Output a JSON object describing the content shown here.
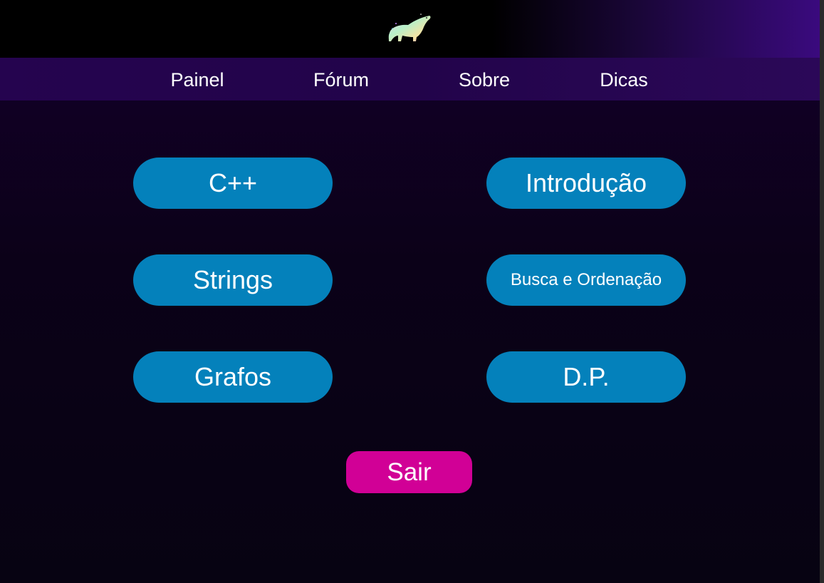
{
  "header": {
    "logo_icon": "polar-bear-logo-icon"
  },
  "nav": {
    "items": [
      {
        "label": "Painel"
      },
      {
        "label": "Fórum"
      },
      {
        "label": "Sobre"
      },
      {
        "label": "Dicas"
      }
    ]
  },
  "topics": {
    "buttons": [
      {
        "label": "C++"
      },
      {
        "label": "Introdução"
      },
      {
        "label": "Strings"
      },
      {
        "label": "Busca e Ordenação"
      },
      {
        "label": "Grafos"
      },
      {
        "label": "D.P."
      }
    ]
  },
  "exit": {
    "label": "Sair"
  },
  "colors": {
    "topic_button": "#0481bb",
    "exit_button": "#d10096",
    "navbar": "#25044f",
    "background": "#0b0118",
    "accent_gradient_end": "#3a0a7e"
  }
}
